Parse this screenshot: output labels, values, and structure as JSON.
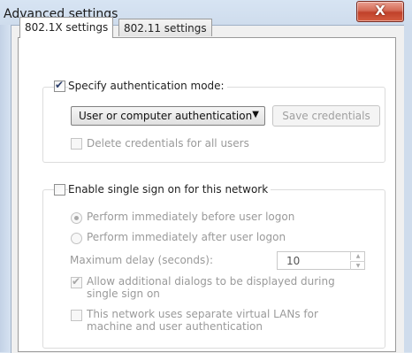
{
  "window": {
    "title": "Advanced settings",
    "close_label": "X"
  },
  "tabs": [
    "802.1X settings",
    "802.11 settings"
  ],
  "auth": {
    "specify_label": "Specify authentication mode:",
    "specify_checked": true,
    "mode_value": "User or computer authentication",
    "save_credentials_label": "Save credentials",
    "delete_credentials_label": "Delete credentials for all users"
  },
  "sso": {
    "enable_label": "Enable single sign on for this network",
    "enable_checked": false,
    "before_logon_label": "Perform immediately before user logon",
    "after_logon_label": "Perform immediately after user logon",
    "max_delay_label": "Maximum delay (seconds):",
    "max_delay_value": "10",
    "allow_dialogs_label": "Allow additional dialogs to be displayed during single sign on",
    "allow_dialogs_checked": true,
    "separate_vlan_label": "This network uses separate virtual LANs for machine and user authentication"
  }
}
